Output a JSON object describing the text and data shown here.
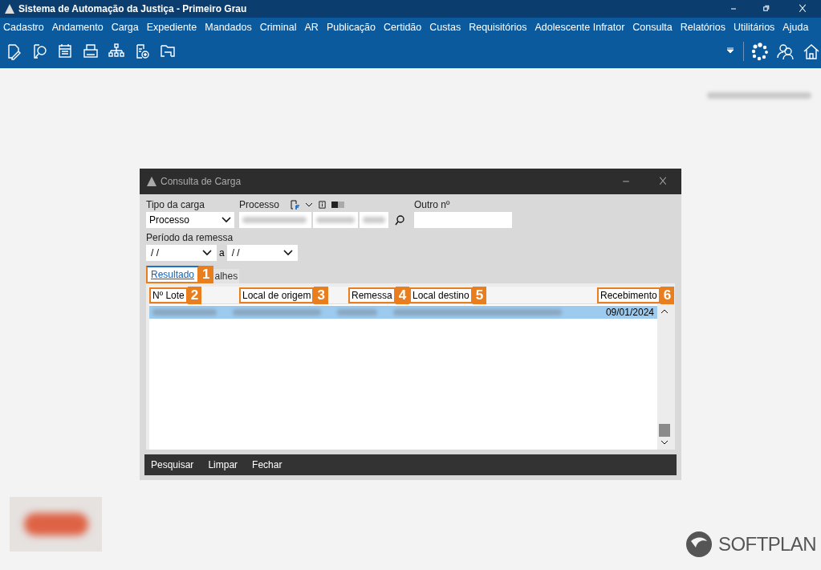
{
  "window": {
    "title": "Sistema de Automação da Justiça - Primeiro Grau"
  },
  "menu": [
    "Cadastro",
    "Andamento",
    "Carga",
    "Expediente",
    "Mandados",
    "Criminal",
    "AR",
    "Publicação",
    "Certidão",
    "Custas",
    "Requisitórios",
    "Adolescente Infrator",
    "Consulta",
    "Relatórios",
    "Utilitários",
    "Ajuda"
  ],
  "dialog": {
    "title": "Consulta de Carga",
    "tipo": {
      "label": "Tipo da carga",
      "value": "Processo"
    },
    "processo": {
      "label": "Processo"
    },
    "outro": {
      "label": "Outro nº"
    },
    "periodo": {
      "label": "Período da remessa",
      "from": "/ /",
      "separator": "a",
      "to": "/ /"
    },
    "tabs": [
      {
        "label": "Resultado",
        "selected": true,
        "marker": "1"
      },
      {
        "label": "alhes",
        "selected": false
      }
    ],
    "columns": [
      {
        "label": "Nº Lote",
        "marker": "2"
      },
      {
        "label": "Local de origem",
        "marker": "3"
      },
      {
        "label": "Remessa",
        "marker": "4"
      },
      {
        "label": "Local destino",
        "marker": "5"
      },
      {
        "label": "Recebimento",
        "marker": "6"
      }
    ],
    "rows": [
      {
        "selected": true,
        "recebimento": "09/01/2024"
      }
    ],
    "buttons": [
      "Pesquisar",
      "Limpar",
      "Fechar"
    ]
  },
  "brand": "SOFTPLAN"
}
